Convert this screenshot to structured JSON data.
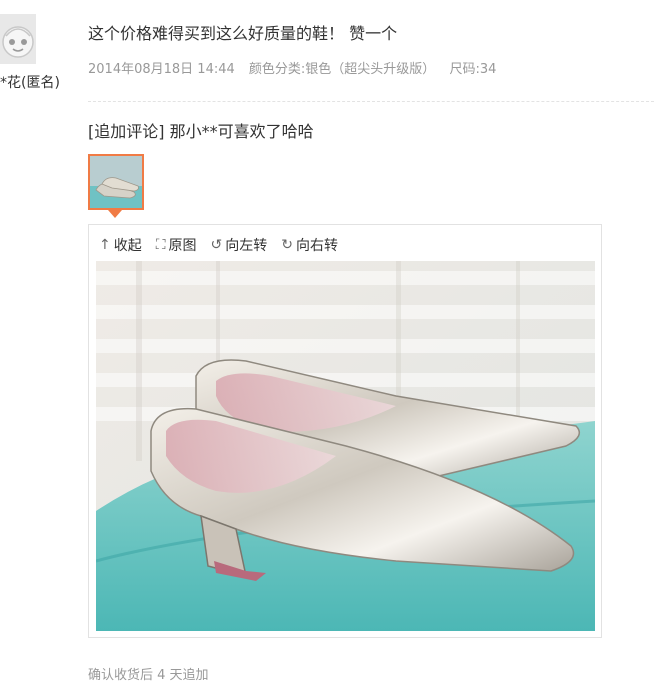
{
  "reviewer": {
    "name": "*花(匿名)"
  },
  "review": {
    "text": "这个价格难得买到这么好质量的鞋！ 赞一个",
    "date": "2014年08月18日 14:44",
    "color": "颜色分类:银色（超尖头升级版）",
    "size": "尺码:34"
  },
  "append": {
    "tag": "[追加评论]",
    "text": "那小**可喜欢了哈哈"
  },
  "viewer": {
    "collapse": "收起",
    "original": "原图",
    "rotate_left": "向左转",
    "rotate_right": "向右转"
  },
  "footer": {
    "text": "确认收货后 4 天追加"
  },
  "colors": {
    "accent": "#f07b45",
    "muted": "#999999"
  },
  "icons": [
    "avatar-face-icon",
    "collapse-icon",
    "expand-icon",
    "rotate-left-icon",
    "rotate-right-icon"
  ]
}
